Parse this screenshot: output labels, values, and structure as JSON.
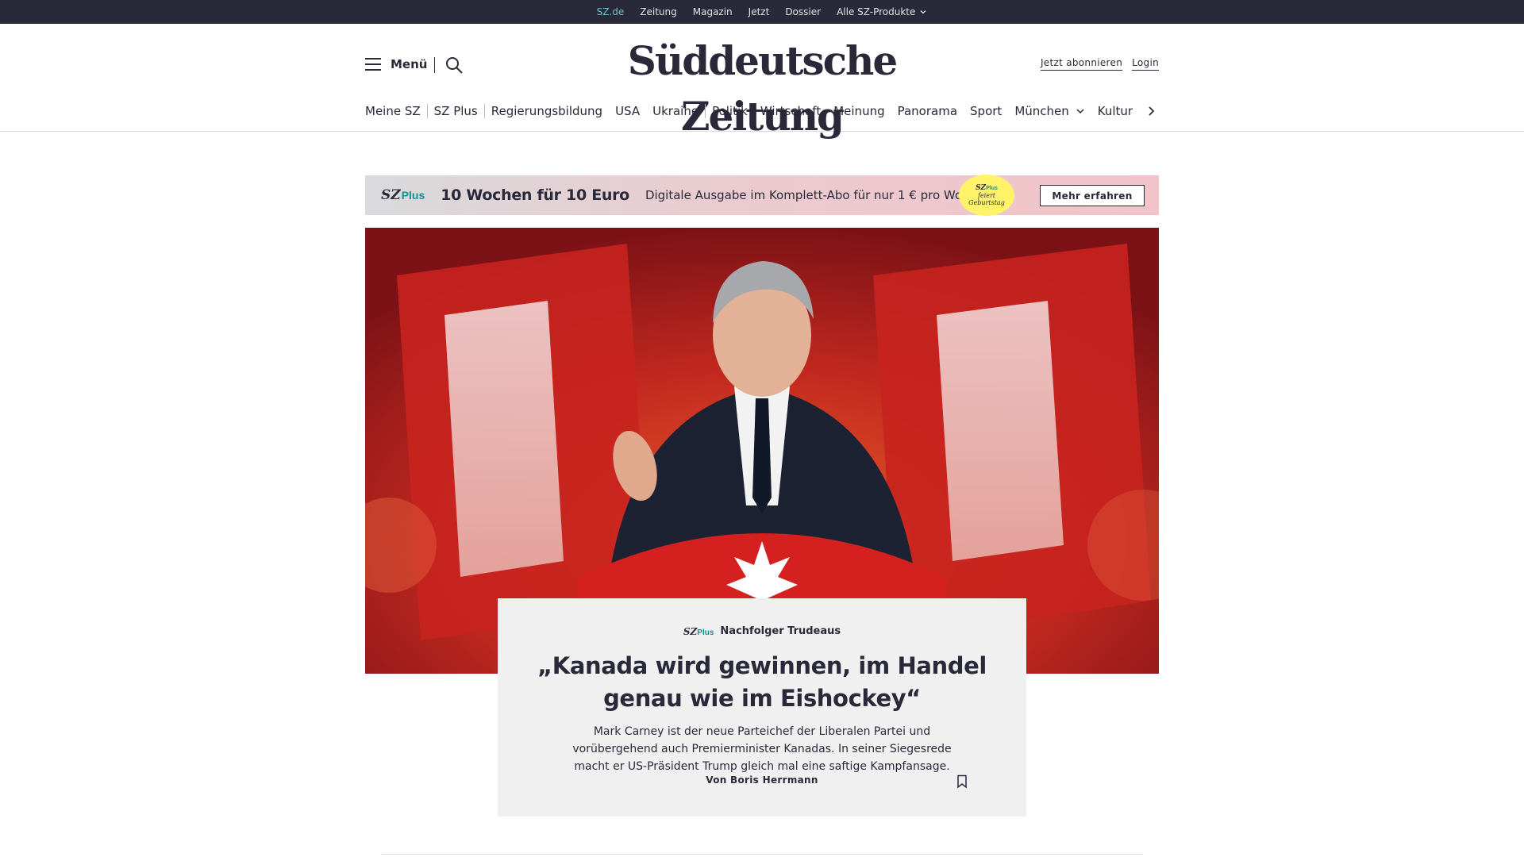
{
  "topbar": {
    "links": [
      {
        "label": "SZ.de",
        "active": true
      },
      {
        "label": "Zeitung"
      },
      {
        "label": "Magazin"
      },
      {
        "label": "Jetzt"
      },
      {
        "label": "Dossier"
      },
      {
        "label": "Alle SZ-Produkte",
        "has_dropdown": true
      }
    ]
  },
  "header": {
    "menu_label": "Menü",
    "logo_text": "Süddeutsche Zeitung",
    "subscribe_label": "Jetzt abonnieren",
    "login_label": "Login"
  },
  "nav": {
    "items": [
      "Meine SZ",
      "SZ Plus",
      "Regierungsbildung",
      "USA",
      "Ukraine",
      "Politik",
      "Wirtschaft",
      "Meinung",
      "Panorama",
      "Sport",
      "München",
      "Kultur"
    ]
  },
  "promo": {
    "logo_sz": "SZ",
    "logo_plus": "Plus",
    "title": "10 Wochen für 10 Euro",
    "text": "Digitale Ausgabe im Komplett-Abo für nur 1 € pro Woche.",
    "badge_logo_sz": "SZ",
    "badge_logo_plus": "Plus",
    "badge_line1": "feiert",
    "badge_line2": "Geburtstag",
    "button_label": "Mehr erfahren"
  },
  "article": {
    "kicker_logo_sz": "SZ",
    "kicker_logo_plus": "Plus",
    "kicker": "Nachfolger Trudeaus",
    "headline": "„Kanada wird gewinnen, im Handel genau wie im Eishockey“",
    "summary": "Mark Carney ist der neue Parteichef der Liberalen Partei und vorübergehend auch Premierminister Kanadas. In seiner Siegesrede macht er US-Präsident Trump gleich mal eine saftige Kampfansage.",
    "byline": "Von Boris Herrmann"
  },
  "colors": {
    "brand_dark": "#29293a",
    "plus_accent": "#11938f",
    "active_topbar_link": "#71c3c6",
    "badge_yellow": "#fff36a"
  }
}
